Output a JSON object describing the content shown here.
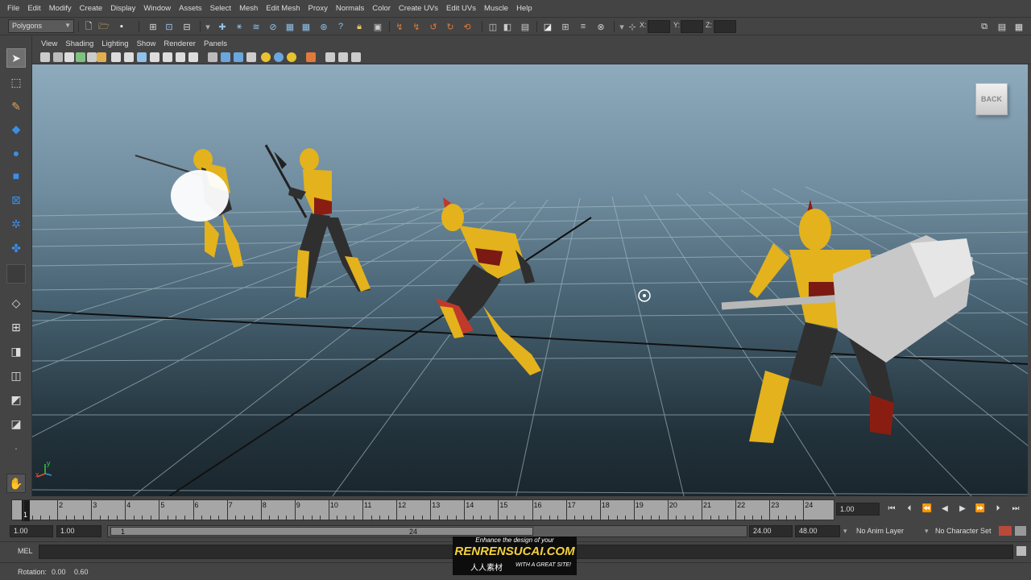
{
  "menubar": {
    "items": [
      "File",
      "Edit",
      "Modify",
      "Create",
      "Display",
      "Window",
      "Assets",
      "Select",
      "Mesh",
      "Edit Mesh",
      "Proxy",
      "Normals",
      "Color",
      "Create UVs",
      "Edit UVs",
      "Muscle",
      "Help"
    ]
  },
  "statusline": {
    "menuset": "Polygons",
    "x_label": "X:",
    "y_label": "Y:",
    "z_label": "Z:"
  },
  "panel_menu": {
    "items": [
      "View",
      "Shading",
      "Lighting",
      "Show",
      "Renderer",
      "Panels"
    ]
  },
  "viewport": {
    "viewcube_label": "BACK",
    "axis_x": "x",
    "axis_y": "y"
  },
  "timeslider": {
    "ticks": [
      "1",
      "2",
      "3",
      "4",
      "5",
      "6",
      "7",
      "8",
      "9",
      "10",
      "11",
      "12",
      "13",
      "14",
      "15",
      "16",
      "17",
      "18",
      "19",
      "20",
      "21",
      "22",
      "23",
      "24"
    ],
    "current_frame_marker": "1",
    "current_time": "1.00"
  },
  "range": {
    "start": "1.00",
    "playback_start": "1.00",
    "slider_start_label": "1",
    "slider_end_label": "24",
    "playback_end": "24.00",
    "end": "48.00",
    "anim_layer": "No Anim Layer",
    "character_set": "No Character Set"
  },
  "command_line": {
    "label": "MEL"
  },
  "help_line": {
    "rotation_label": "Rotation:",
    "rotation_x": "0.00",
    "rotation_y": "0.60"
  },
  "watermark": {
    "line1": "Enhance the design of your",
    "line2": "RENRENSUCAI.COM",
    "line3": "人人素材",
    "line4": "WITH A GREAT SITE!"
  },
  "colors": {
    "ui_bg": "#444444",
    "armor_gold": "#e3b21c",
    "weapon_grey": "#c8c8c8",
    "grid_line": "#9fb4c0"
  }
}
